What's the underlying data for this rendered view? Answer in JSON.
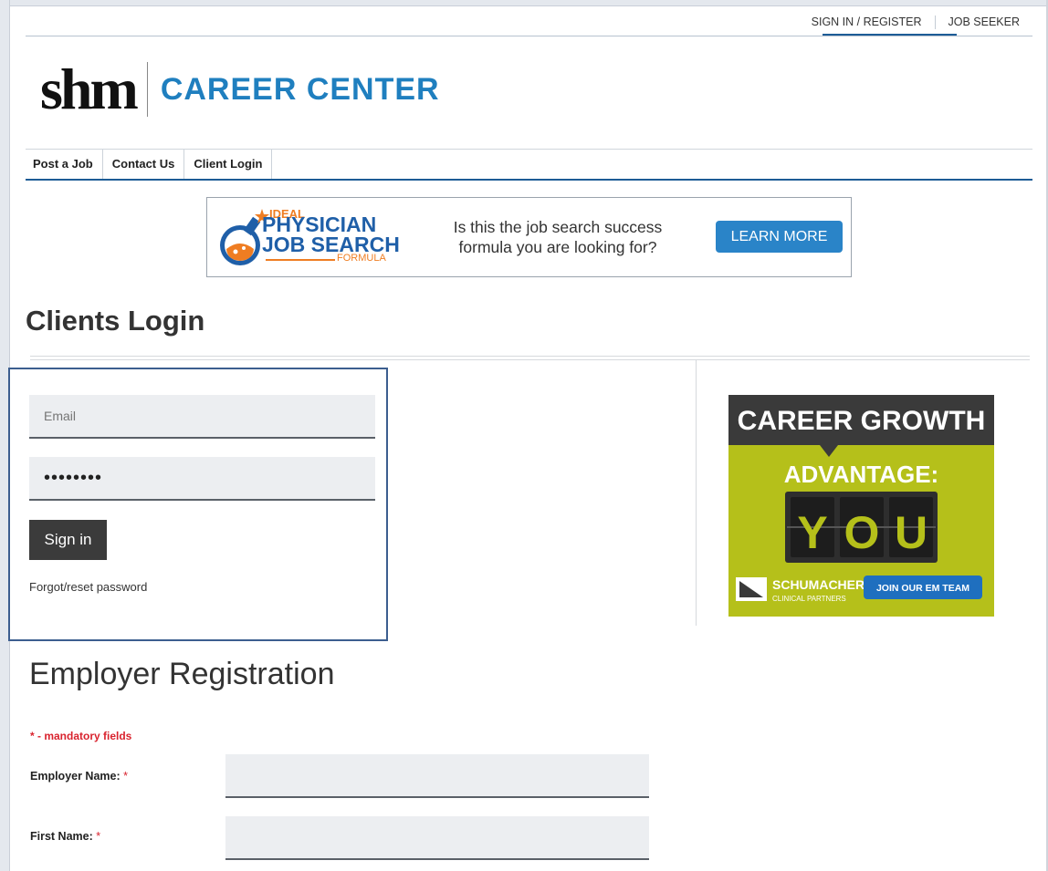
{
  "util_nav": {
    "signin_register": "SIGN IN / REGISTER",
    "job_seeker": "JOB SEEKER"
  },
  "logo": {
    "mark": "shm",
    "text": "CAREER CENTER"
  },
  "main_nav": {
    "items": [
      "Post a Job",
      "Contact Us",
      "Client Login"
    ]
  },
  "banner_ad": {
    "ideal": "IDEAL",
    "physician": "PHYSICIAN",
    "job_search": "JOB SEARCH",
    "formula": "FORMULA",
    "tagline_line1": "Is this the job search success",
    "tagline_line2": "formula you are looking for?",
    "cta": "LEARN MORE"
  },
  "clients_login": {
    "title": "Clients Login",
    "email_placeholder": "Email",
    "password_value": "••••••••",
    "signin_label": "Sign in",
    "forgot_label": "Forgot/reset password"
  },
  "side_ad": {
    "headline": "CAREER GROWTH",
    "subhead": "ADVANTAGE:",
    "letters": [
      "Y",
      "O",
      "U"
    ],
    "brand": "SCHUMACHER",
    "brand_sub": "CLINICAL PARTNERS",
    "cta": "JOIN OUR EM TEAM"
  },
  "employer_registration": {
    "title": "Employer Registration",
    "mandatory_note": "* - mandatory fields",
    "fields": [
      {
        "label": "Employer Name:",
        "required": "*"
      },
      {
        "label": "First Name:",
        "required": "*"
      }
    ]
  },
  "colors": {
    "brand_blue": "#1f7fbf",
    "nav_rule": "#1d5c96",
    "required_red": "#d9232e",
    "ad_green": "#b5c01a"
  }
}
